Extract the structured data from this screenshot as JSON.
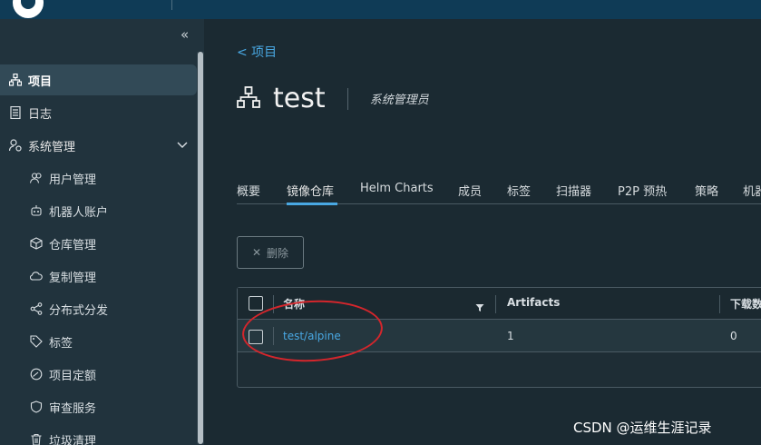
{
  "sidebar": {
    "items": [
      {
        "label": "项目",
        "icon": "project-icon",
        "active": true
      },
      {
        "label": "日志",
        "icon": "log-icon"
      },
      {
        "label": "系统管理",
        "icon": "admin-icon",
        "expandable": true
      }
    ],
    "sub_items": [
      {
        "label": "用户管理",
        "icon": "users-icon"
      },
      {
        "label": "机器人账户",
        "icon": "robot-icon"
      },
      {
        "label": "仓库管理",
        "icon": "registry-icon"
      },
      {
        "label": "复制管理",
        "icon": "cloud-replication-icon"
      },
      {
        "label": "分布式分发",
        "icon": "share-icon"
      },
      {
        "label": "标签",
        "icon": "tag-icon"
      },
      {
        "label": "项目定额",
        "icon": "quota-icon"
      },
      {
        "label": "审查服务",
        "icon": "shield-icon"
      },
      {
        "label": "垃圾清理",
        "icon": "trash-icon"
      }
    ]
  },
  "header": {
    "back_label": "<  项目",
    "title": "test",
    "role": "系统管理员"
  },
  "tabs": [
    "概要",
    "镜像仓库",
    "Helm Charts",
    "成员",
    "标签",
    "扫描器",
    "P2P 预热",
    "策略",
    "机器"
  ],
  "active_tab": "镜像仓库",
  "toolbar": {
    "delete_label": "删除"
  },
  "table": {
    "columns": [
      "名称",
      "Artifacts",
      "下载数"
    ],
    "rows": [
      {
        "name": "test/alpine",
        "artifacts": "1",
        "pulls": "0"
      }
    ]
  },
  "watermark": "CSDN @运维生涯记录",
  "colors": {
    "accent": "#49a8e3",
    "annotation": "#d4262c",
    "topbar": "#0f3b56"
  }
}
